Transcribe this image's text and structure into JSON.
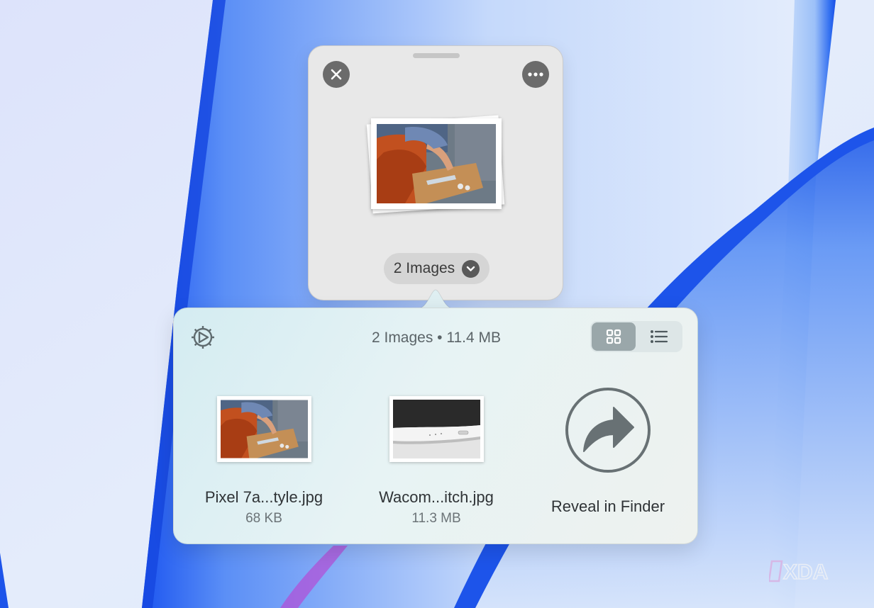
{
  "shelf": {
    "item_count_label": "2 Images"
  },
  "popover": {
    "summary": "2 Images • 11.4 MB",
    "view_mode": "grid",
    "files": [
      {
        "name": "Pixel 7a...tyle.jpg",
        "size": "68 KB"
      },
      {
        "name": "Wacom...itch.jpg",
        "size": "11.3 MB"
      }
    ],
    "reveal_label": "Reveal in Finder"
  },
  "watermark": {
    "text": "XDA"
  },
  "colors": {
    "shelf_bg": "#e8e8e8",
    "button_gray": "#6b6b6b",
    "popover_bg": "#e3f1f3",
    "toggle_active": "#9aa7aa",
    "wallpaper_blue": "#2f6df0"
  },
  "icons": {
    "close": "close-icon",
    "more": "ellipsis-icon",
    "chevron": "chevron-down-icon",
    "gear": "gear-icon",
    "grid_view": "grid-view-icon",
    "list_view": "list-view-icon",
    "reveal": "share-arrow-icon"
  }
}
